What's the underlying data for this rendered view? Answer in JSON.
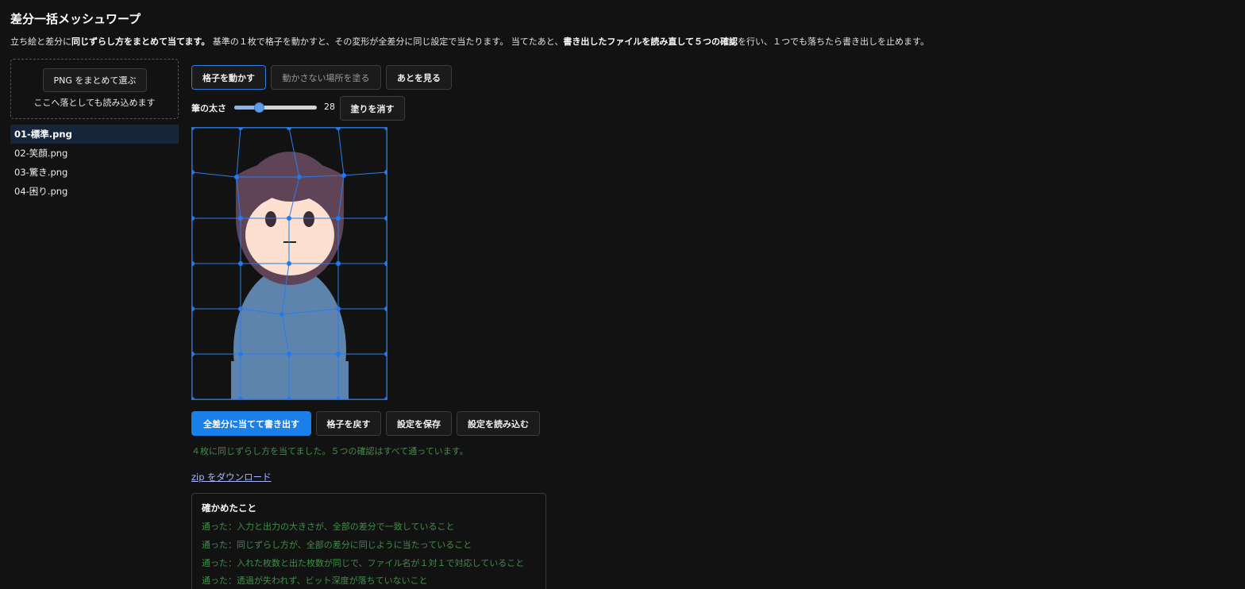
{
  "app": {
    "title": "差分一括メッシュワープ",
    "intro": {
      "p1": "立ち絵と差分に",
      "b1": "同じずらし方をまとめて当てます。",
      "p2": " 基準の１枚で格子を動かすと、その変形が全差分に同じ設定で当たります。 当てたあと、",
      "b2": "書き出したファイルを読み直して５つの確認",
      "p3": "を行い、１つでも落ちたら書き出しを止めます。"
    }
  },
  "sidebar": {
    "pick_button": "PNG をまとめて選ぶ",
    "drop_hint": "ここへ落としても読み込めます",
    "files": [
      {
        "label": "01-標準.png",
        "active": true
      },
      {
        "label": "02-笑顔.png",
        "active": false
      },
      {
        "label": "03-驚き.png",
        "active": false
      },
      {
        "label": "04-困り.png",
        "active": false
      }
    ]
  },
  "toolbar": {
    "mode_move": "格子を動かす",
    "mode_paint": "動かさない場所を塗る",
    "mode_after": "あとを見る",
    "brush_label": "筆の太さ",
    "brush_value": "28",
    "brush_fraction": 0.3,
    "clear_paint": "塗りを消す"
  },
  "actions": {
    "apply": "全差分に当てて書き出す",
    "reset_grid": "格子を戻す",
    "save_settings": "設定を保存",
    "load_settings": "設定を読み込む"
  },
  "result": {
    "status": "４枚に同じずらし方を当てました。５つの確認はすべて通っています。",
    "zip_link": "zip をダウンロード",
    "checks_title": "確かめたこと",
    "checks": [
      "通った：入力と出力の大きさが、全部の差分で一致していること",
      "通った：同じずらし方が、全部の差分に同じように当たっていること",
      "通った：入れた枚数と出た枚数が同じで、ファイル名が１対１で対応していること",
      "通った：透過が失われず、ビット深度が落ちていないこと"
    ]
  },
  "colors": {
    "accent": "#1a7fe8",
    "mesh": "#2b7de9",
    "ok": "#3f8f4a",
    "hair": "#5e4456",
    "skin": "#fde0cf",
    "body": "#5e84ad"
  }
}
